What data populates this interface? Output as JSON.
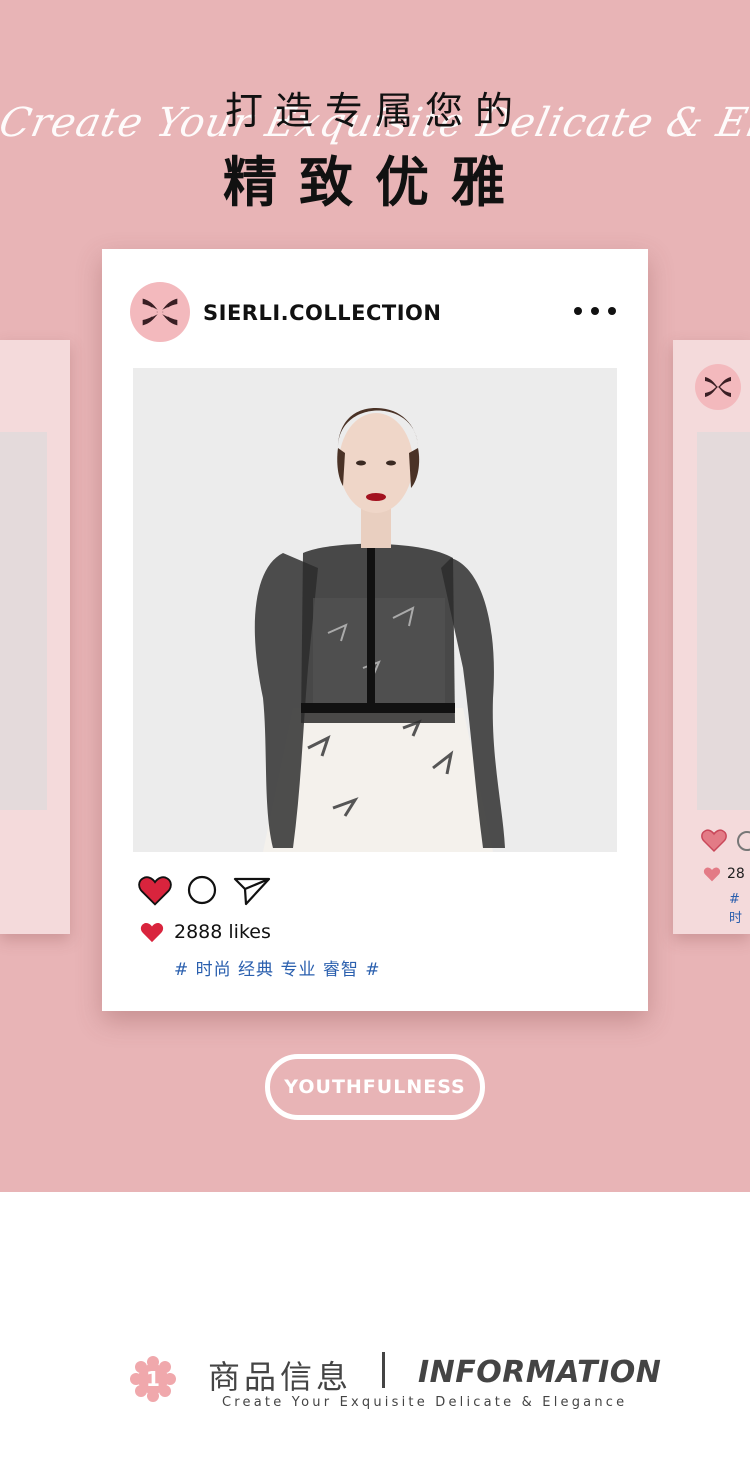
{
  "hero": {
    "script_line": "Create Your Exquisite Delicate & Elegance",
    "title_line1": "打造专属您的",
    "title_line2": "精致优雅"
  },
  "post": {
    "username": "SIERLI.COLLECTION",
    "likes_text": "2888 likes",
    "hashtags": "# 时尚 经典 专业 睿智 #",
    "icons": [
      "logo-icon",
      "more-options-icon",
      "heart-filled-icon",
      "comment-icon",
      "send-icon"
    ]
  },
  "side_card_right": {
    "likes_text": "28",
    "tag_text": "# 时"
  },
  "cta": {
    "label": "YOUTHFULNESS"
  },
  "info_section": {
    "badge_number": "1",
    "title_cn": "商品信息",
    "title_en": "INFORMATION",
    "subtitle": "Create Your Exquisite Delicate & Elegance"
  },
  "colors": {
    "background_pink": "#e8b4b6",
    "avatar_pink": "#f3b9bd",
    "heart_red": "#d9243d",
    "hashtag_blue": "#2a5fae",
    "badge_pink": "#f0a8ac"
  }
}
